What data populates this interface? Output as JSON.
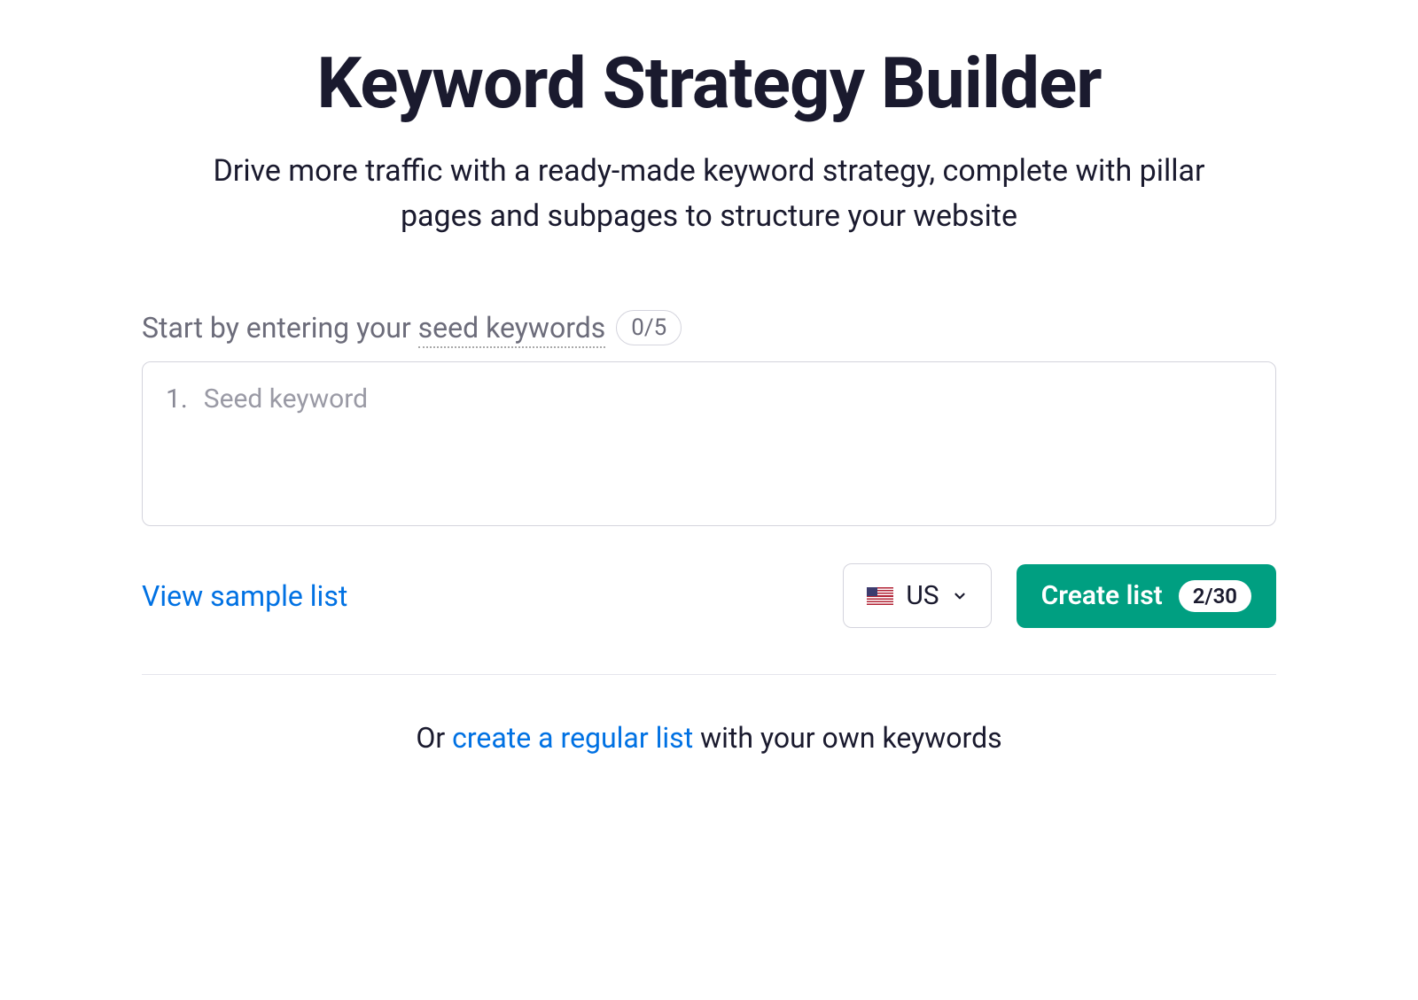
{
  "header": {
    "title": "Keyword Strategy Builder",
    "subtitle": "Drive more traffic with a ready-made keyword strategy, complete with pillar pages and subpages to structure your website"
  },
  "form": {
    "label_prefix": "Start by entering your ",
    "label_term": "seed keywords",
    "count_badge": "0/5",
    "rows": [
      {
        "number": "1.",
        "placeholder": "Seed keyword"
      }
    ]
  },
  "actions": {
    "view_sample_label": "View sample list",
    "country": {
      "code": "US"
    },
    "create_list": {
      "label": "Create list",
      "count": "2/30"
    }
  },
  "alternative": {
    "prefix": "Or ",
    "link_text": "create a regular list",
    "suffix": " with your own keywords"
  }
}
